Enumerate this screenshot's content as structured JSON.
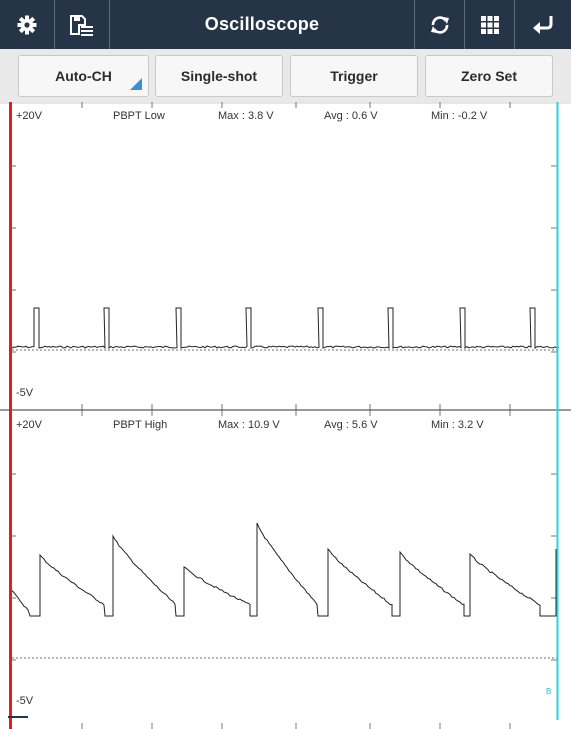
{
  "header": {
    "title": "Oscilloscope",
    "icons": [
      "gear-icon",
      "save-list-icon",
      "refresh-icon",
      "grid-icon",
      "back-icon"
    ]
  },
  "buttons": {
    "auto_ch": "Auto-CH",
    "single_shot": "Single-shot",
    "trigger": "Trigger",
    "zero_set": "Zero Set"
  },
  "channels": [
    {
      "top_label": "+20V",
      "name": "PBPT Low",
      "max": "Max : 3.8 V",
      "avg": "Avg : 0.6 V",
      "min": "Min : -0.2 V",
      "bottom_label": "-5V"
    },
    {
      "top_label": "+20V",
      "name": "PBPT High",
      "max": "Max : 10.9 V",
      "avg": "Avg : 5.6 V",
      "min": "Min : 3.2 V",
      "bottom_label": "-5V"
    }
  ],
  "cursor_marker": "B",
  "colors": {
    "header_bg": "#263447",
    "left_cursor": "#e02020",
    "right_cursor": "#29d3e6",
    "trace": "#222222"
  }
}
